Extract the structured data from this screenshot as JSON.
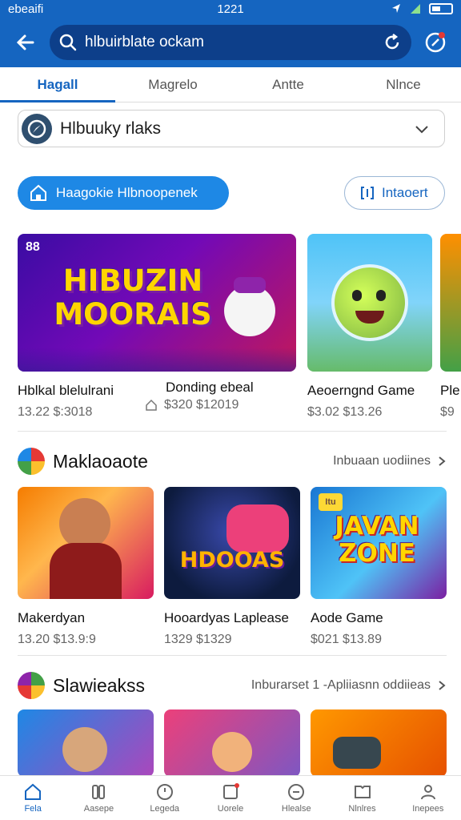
{
  "status": {
    "carrier": "ebeaifi",
    "time": "1221"
  },
  "search": {
    "value": "hlbuirblate ockam"
  },
  "tabs": [
    {
      "label": "Hagall"
    },
    {
      "label": "Magrelo"
    },
    {
      "label": "Antte"
    },
    {
      "label": "Nlnce"
    }
  ],
  "category_select": {
    "value": "Hlbuuky rlaks"
  },
  "actions": {
    "primary_label": "Haagokie Hlbnoopenek",
    "secondary_label": "Intaoert"
  },
  "featured": {
    "items": [
      {
        "title": "Hblkal blelulrani",
        "price": "13.22 $:3018",
        "art": "HIBUZIN MOORAIS",
        "badge": "88"
      },
      {
        "title": "Donding ebeal",
        "price": "$320 $12019"
      },
      {
        "title": "Aeoerngnd Game",
        "price": "$3.02 $13.26"
      },
      {
        "title": "Ple",
        "price": "$9"
      }
    ]
  },
  "sections": [
    {
      "title": "Maklaoaote",
      "more": "Inbuaan uodiines",
      "items": [
        {
          "title": "Makerdyan",
          "price": "13.20 $13.9:9"
        },
        {
          "title": "Hooardyas Laplease",
          "price": "1329 $1329",
          "art": "HDOOAS"
        },
        {
          "title": "Aode Game",
          "price": "$021 $13.89",
          "art": "JAVAN ZONE",
          "art_badge": "Itu"
        }
      ]
    },
    {
      "title": "Slawieakss",
      "more": "Inburarset 1 -Apliiasnn oddiieas",
      "items": [
        {},
        {},
        {}
      ]
    }
  ],
  "bottom_nav": [
    {
      "label": "Fela"
    },
    {
      "label": "Aasepe"
    },
    {
      "label": "Legeda"
    },
    {
      "label": "Uorele"
    },
    {
      "label": "Hlealse"
    },
    {
      "label": "Nlnlres"
    },
    {
      "label": "Inepees"
    }
  ],
  "colors": {
    "brand": "#1565c0",
    "accent": "#1e88e5"
  }
}
